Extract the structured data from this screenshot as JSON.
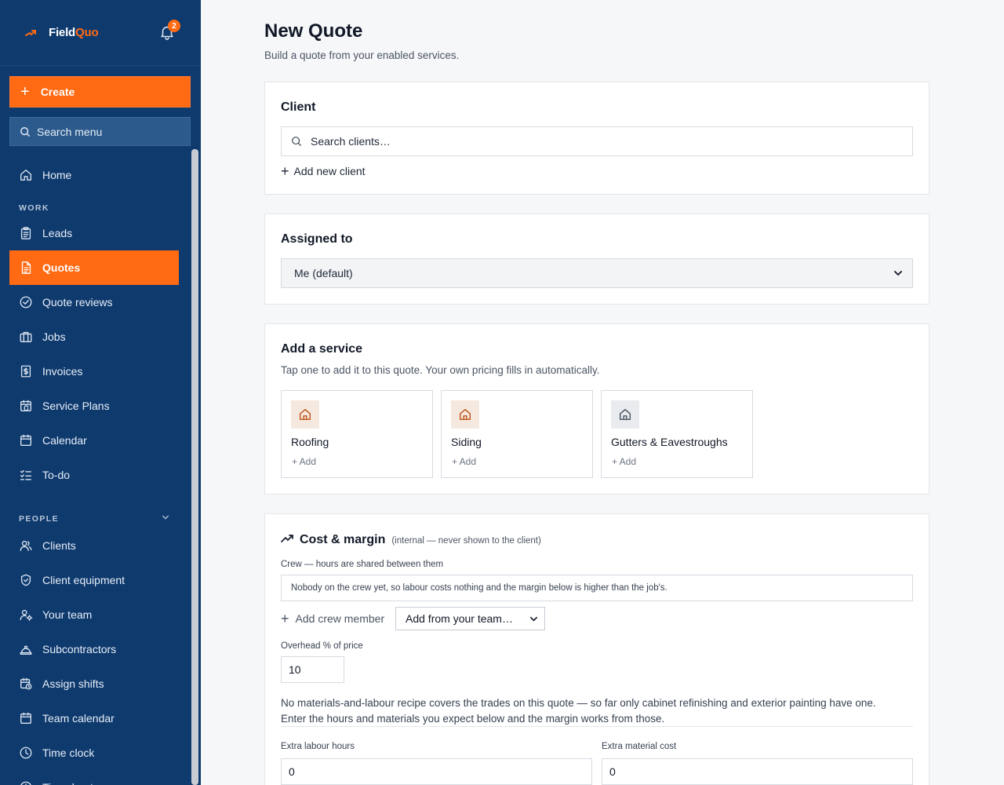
{
  "brand": {
    "name_white": "Field",
    "name_orange": "Quo",
    "accent": "#ff6a13",
    "sidebar_bg": "#0e3a6e"
  },
  "notifications": {
    "count": "2"
  },
  "sidebar": {
    "create_label": "Create",
    "search_label": "Search menu",
    "items": [
      {
        "label": "Home",
        "icon": "home-icon"
      },
      {
        "section": "WORK"
      },
      {
        "label": "Leads",
        "icon": "clipboard-icon"
      },
      {
        "label": "Quotes",
        "icon": "document-icon",
        "active": true
      },
      {
        "label": "Quote reviews",
        "icon": "check-circle-icon"
      },
      {
        "label": "Jobs",
        "icon": "briefcase-icon"
      },
      {
        "label": "Invoices",
        "icon": "dollar-file-icon"
      },
      {
        "label": "Service Plans",
        "icon": "calendar-sync-icon"
      },
      {
        "label": "Calendar",
        "icon": "calendar-icon"
      },
      {
        "label": "To-do",
        "icon": "checklist-icon"
      },
      {
        "section": "PEOPLE"
      },
      {
        "label": "Clients",
        "icon": "users-icon"
      },
      {
        "label": "Client equipment",
        "icon": "shield-check-icon"
      },
      {
        "label": "Your team",
        "icon": "user-gear-icon"
      },
      {
        "label": "Subcontractors",
        "icon": "hard-hat-icon"
      },
      {
        "label": "Assign shifts",
        "icon": "calendar-clock-icon"
      },
      {
        "label": "Team calendar",
        "icon": "calendar-icon"
      },
      {
        "label": "Time clock",
        "icon": "clock-icon"
      },
      {
        "label": "Timesheets",
        "icon": "clock-icon"
      }
    ]
  },
  "page": {
    "title": "New Quote",
    "subtitle": "Build a quote from your enabled services."
  },
  "client": {
    "heading": "Client",
    "search_placeholder": "Search clients…",
    "add_new": "Add new client"
  },
  "assigned": {
    "heading": "Assigned to",
    "value": "Me (default)"
  },
  "services": {
    "heading": "Add a service",
    "hint": "Tap one to add it to this quote. Your own pricing fills in automatically.",
    "items": [
      {
        "name": "Roofing",
        "add": "+ Add",
        "tint": "#f5e9df"
      },
      {
        "name": "Siding",
        "add": "+ Add",
        "tint": "#f5e9df"
      },
      {
        "name": "Gutters & Eavestroughs",
        "add": "+ Add",
        "tint": "#e9ebee"
      }
    ]
  },
  "cost": {
    "heading": "Cost & margin",
    "internal_note": "(internal — never shown to the client)",
    "crew_label": "Crew — hours are shared between them",
    "crew_message": "Nobody on the crew yet, so labour costs nothing and the margin below is higher than the job's.",
    "add_crew": "Add crew member",
    "add_from_team": "Add from your team…",
    "overhead_label": "Overhead % of price",
    "overhead_value": "10",
    "recipe_note_1": "No materials-and-labour recipe covers the trades on this quote — so far only cabinet refinishing and exterior painting have one.",
    "recipe_note_2": "Enter the hours and materials you expect below and the margin works from those.",
    "extra_hours_label": "Extra labour hours",
    "extra_hours_value": "0",
    "extra_material_label": "Extra material cost",
    "extra_material_value": "0"
  }
}
